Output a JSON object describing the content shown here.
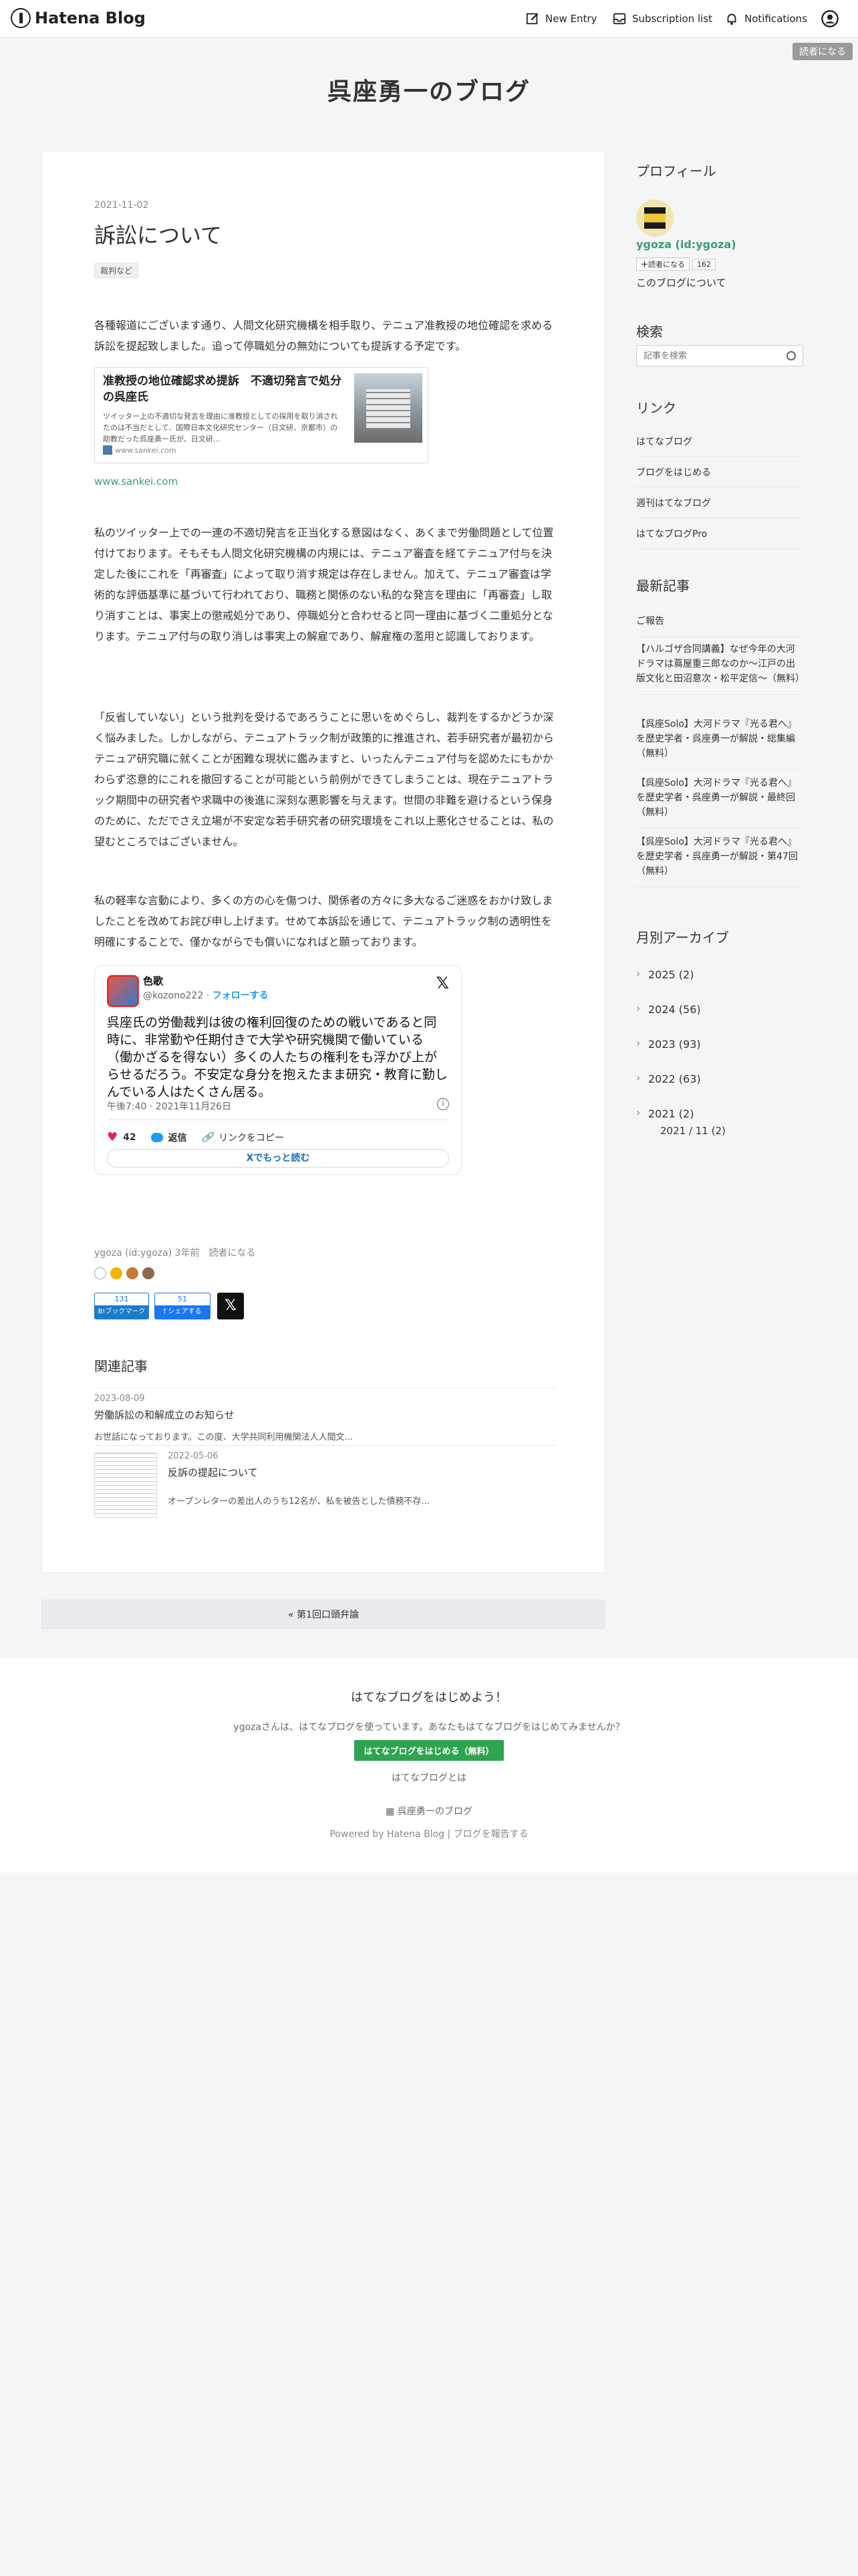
{
  "header": {
    "logo_text": "Hatena Blog",
    "new_entry": "New Entry",
    "subscription_list": "Subscription list",
    "notifications": "Notifications",
    "reader_badge": "読者になる"
  },
  "blog": {
    "title": "呉座勇一のブログ"
  },
  "entry": {
    "date": "2021-11-02",
    "title": "訴訟について",
    "category": "裁判など",
    "p1": "各種報道にございます通り、人間文化研究機構を相手取り、テニュア准教授の地位確認を求める訴訟を提起致しました。追って停職処分の無効についても提訴する予定です。",
    "embed": {
      "title": "准教授の地位確認求め提訴　不適切発言で処分の呉座氏",
      "desc": "ツイッター上の不適切な発言を理由に准教授としての採用を取り消されたのは不当だとして、国際日本文化研究センター（日文研、京都市）の助教だった呉座勇一氏が、日文研...",
      "site": "www.sankei.com"
    },
    "source_link": "www.sankei.com",
    "p2": "私のツイッター上での一連の不適切発言を正当化する意図はなく、あくまで労働問題として位置付けております。そもそも人間文化研究機構の内規には、テニュア審査を経てテニュア付与を決定した後にこれを「再審査」によって取り消す規定は存在しません。加えて、テニュア審査は学術的な評価基準に基づいて行われており、職務と関係のない私的な発言を理由に「再審査」し取り消すことは、事実上の懲戒処分であり、停職処分と合わせると同一理由に基づく二重処分となります。テニュア付与の取り消しは事実上の解雇であり、解雇権の濫用と認識しております。",
    "p3": "「反省していない」という批判を受けるであろうことに思いをめぐらし、裁判をするかどうか深く悩みました。しかしながら、テニュアトラック制が政策的に推進され、若手研究者が最初からテニュア研究職に就くことが困難な現状に鑑みますと、いったんテニュア付与を認めたにもかかわらず恣意的にこれを撤回することが可能という前例ができてしまうことは、現在テニュアトラック期間中の研究者や求職中の後進に深刻な悪影響を与えます。世間の非難を避けるという保身のために、ただでさえ立場が不安定な若手研究者の研究環境をこれ以上悪化させることは、私の望むところではございません。",
    "p4": "私の軽率な言動により、多くの方の心を傷つけ、関係者の方々に多大なるご迷惑をおかけ致しましたことを改めてお詫び申し上げます。せめて本訴訟を通じて、テニュアトラック制の透明性を明確にすることで、僅かながらでも償いになればと願っております。",
    "tweet": {
      "name": "色歌",
      "handle": "@kozono222",
      "follow": "フォローする",
      "text": "呉座氏の労働裁判は彼の権利回復のための戦いであると同時に、非常勤や任期付きで大学や研究機関で働いている（働かざるを得ない）多くの人たちの権利をも浮かび上がらせるだろう。不安定な身分を抱えたまま研究・教育に勤しんでいる人はたくさん居る。",
      "time": "午後7:40 · 2021年11月26日",
      "likes": "42",
      "reply": "返信",
      "copy_link": "リンクをコピー",
      "read_more": "Xでもっと読む"
    },
    "meta": "ygoza (id:ygoza) 3年前",
    "meta_reader": "読者になる",
    "bookmark_count": "131",
    "bookmark_label": "B!ブックマーク",
    "fb_count": "51",
    "fb_label": "f シェアする",
    "related_title": "関連記事",
    "related": [
      {
        "date": "2023-08-09",
        "title": "労働訴訟の和解成立のお知らせ",
        "excerpt": "お世話になっております。この度、大学共同利用機関法人人間文..."
      },
      {
        "date": "2022-05-06",
        "title": "反訴の提起について",
        "excerpt": "オープンレターの差出人のうち12名が、私を被告とした債務不存..."
      }
    ],
    "pager": "« 第1回口頭弁論"
  },
  "sidebar": {
    "profile_h": "プロフィール",
    "profile_id": "ygoza (id:ygoza)",
    "reader_btn": "読者になる",
    "reader_count": "162",
    "about": "このブログについて",
    "search_h": "検索",
    "search_placeholder": "記事を検索",
    "links_h": "リンク",
    "links": [
      "はてなブログ",
      "ブログをはじめる",
      "週刊はてなブログ",
      "はてなブログPro"
    ],
    "recent_h": "最新記事",
    "recent": [
      "ご報告",
      "【ハルゴザ合同講義】なぜ今年の大河ドラマは蔦屋重三郎なのか～江戸の出版文化と田沼意次・松平定信～（無料）",
      "【呉座Solo】大河ドラマ『光る君へ』を歴史学者・呉座勇一が解説・総集編（無料）",
      "【呉座Solo】大河ドラマ『光る君へ』を歴史学者・呉座勇一が解説・最終回（無料）",
      "【呉座Solo】大河ドラマ『光る君へ』を歴史学者・呉座勇一が解説・第47回（無料）"
    ],
    "archive_h": "月別アーカイブ",
    "archive": [
      "2025 (2)",
      "2024 (56)",
      "2023 (93)",
      "2022 (63)",
      "2021 (2)"
    ],
    "archive_sub": "2021 / 11 (2)"
  },
  "footer": {
    "cta_title": "はてなブログをはじめよう！",
    "cta_text": "ygozaさんは、はてなブログを使っています。あなたもはてなブログをはじめてみませんか？",
    "cta_button": "はてなブログをはじめる（無料）",
    "about_link": "はてなブログとは",
    "blog_link": "呉座勇一のブログ",
    "powered": "Powered by Hatena Blog | ブログを報告する"
  }
}
